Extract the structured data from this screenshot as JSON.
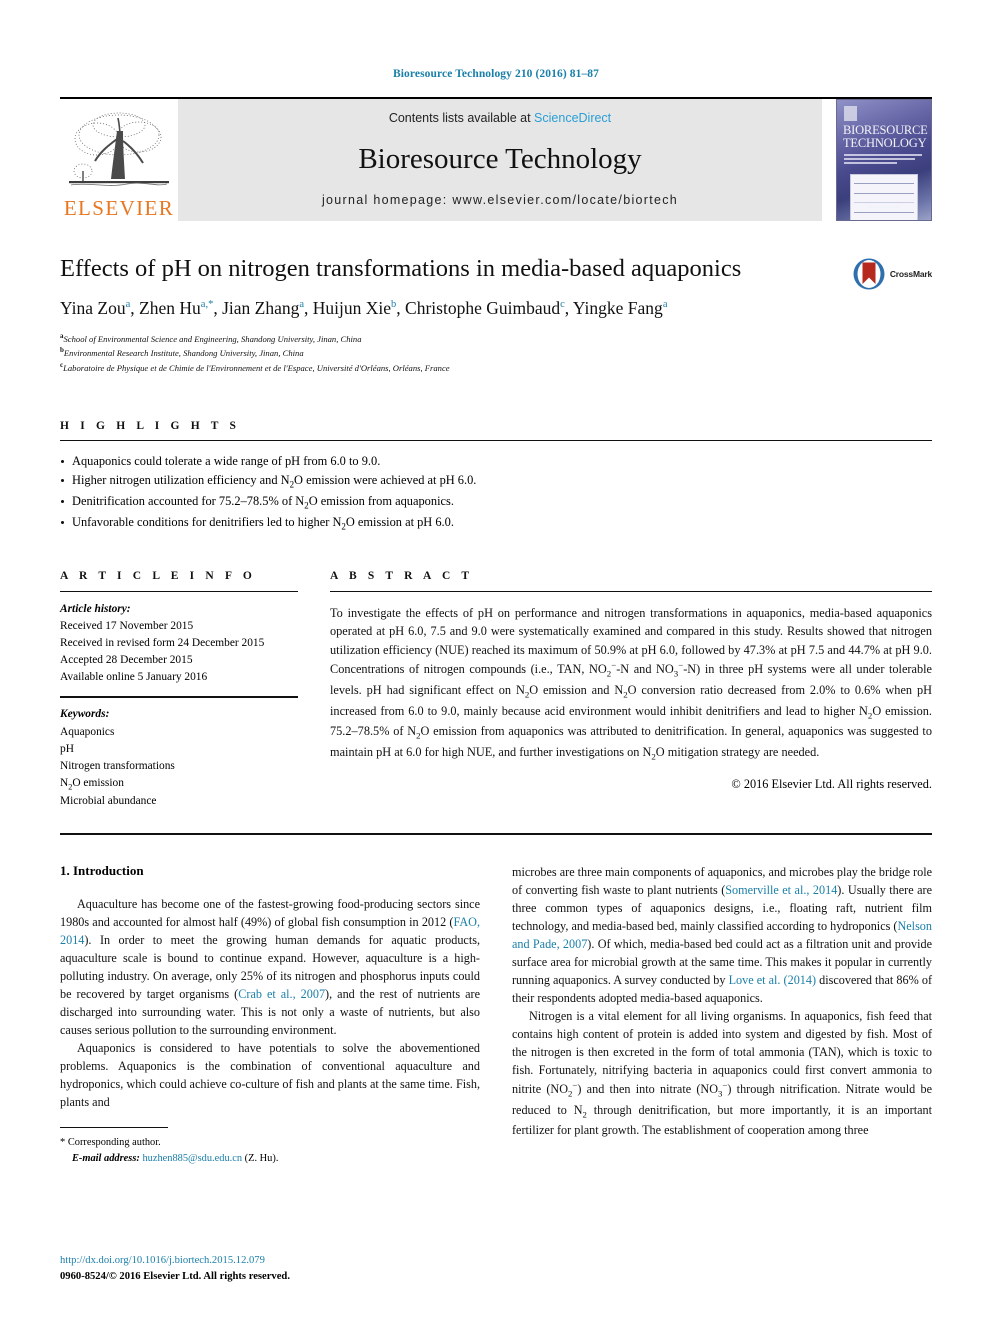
{
  "running_head": "Bioresource Technology 210 (2016) 81–87",
  "masthead": {
    "contents_prefix": "Contents lists available at ",
    "sciencedirect": "ScienceDirect",
    "journal_name": "Bioresource Technology",
    "homepage": "journal homepage: www.elsevier.com/locate/biortech",
    "publisher_logo_text": "ELSEVIER",
    "cover_title_line1": "BIORESOURCE",
    "cover_title_line2": "TECHNOLOGY"
  },
  "article": {
    "title": "Effects of pH on nitrogen transformations in media-based aquaponics",
    "crossmark_label": "CrossMark",
    "authors_html": "Yina Zou<sup>a</sup>, Zhen Hu<sup>a,*</sup>, Jian Zhang<sup>a</sup>, Huijun Xie<sup>b</sup>, Christophe Guimbaud<sup>c</sup>, Yingke Fang<sup>a</sup>",
    "affiliations": [
      {
        "marker": "a",
        "text": "School of Environmental Science and Engineering, Shandong University, Jinan, China"
      },
      {
        "marker": "b",
        "text": "Environmental Research Institute, Shandong University, Jinan, China"
      },
      {
        "marker": "c",
        "text": "Laboratoire de Physique et de Chimie de l'Environnement et de l'Espace, Université d'Orléans, Orléans, France"
      }
    ]
  },
  "highlights": {
    "heading": "H I G H L I G H T S",
    "items_html": [
      "Aquaponics could tolerate a wide range of pH from 6.0 to 9.0.",
      "Higher nitrogen utilization efficiency and N<sub>2</sub>O emission were achieved at pH 6.0.",
      "Denitrification accounted for 75.2–78.5% of N<sub>2</sub>O emission from aquaponics.",
      "Unfavorable conditions for denitrifiers led to higher N<sub>2</sub>O emission at pH 6.0."
    ]
  },
  "article_info": {
    "heading": "A R T I C L E    I N F O",
    "history_head": "Article history:",
    "history": [
      "Received 17 November 2015",
      "Received in revised form 24 December 2015",
      "Accepted 28 December 2015",
      "Available online 5 January 2016"
    ],
    "keywords_head": "Keywords:",
    "keywords_html": [
      "Aquaponics",
      "pH",
      "Nitrogen transformations",
      "N<sub>2</sub>O emission",
      "Microbial abundance"
    ]
  },
  "abstract": {
    "heading": "A B S T R A C T",
    "body_html": "To investigate the effects of pH on performance and nitrogen transformations in aquaponics, media-based aquaponics operated at pH 6.0, 7.5 and 9.0 were systematically examined and compared in this study. Results showed that nitrogen utilization efficiency (NUE) reached its maximum of 50.9% at pH 6.0, followed by 47.3% at pH 7.5 and 44.7% at pH 9.0. Concentrations of nitrogen compounds (i.e., TAN, NO<sub>2</sub><sup class=\"min\">&minus;</sup>-N and NO<sub>3</sub><sup class=\"min\">&minus;</sup>-N) in three pH systems were all under tolerable levels. pH had significant effect on N<sub>2</sub>O emission and N<sub>2</sub>O conversion ratio decreased from 2.0% to 0.6% when pH increased from 6.0 to 9.0, mainly because acid environment would inhibit denitrifiers and lead to higher N<sub>2</sub>O emission. 75.2–78.5% of N<sub>2</sub>O emission from aquaponics was attributed to denitrification. In general, aquaponics was suggested to maintain pH at 6.0 for high NUE, and further investigations on N<sub>2</sub>O mitigation strategy are needed.",
    "copyright": "© 2016 Elsevier Ltd. All rights reserved."
  },
  "introduction": {
    "heading": "1. Introduction",
    "left_paragraphs_html": [
      "Aquaculture has become one of the fastest-growing food-producing sectors since 1980s and accounted for almost half (49%) of global fish consumption in 2012 (<span class=\"ref\">FAO, 2014</span>). In order to meet the growing human demands for aquatic products, aquaculture scale is bound to continue expand. However, aquaculture is a high-polluting industry. On average, only 25% of its nitrogen and phosphorus inputs could be recovered by target organisms (<span class=\"ref\">Crab et al., 2007</span>), and the rest of nutrients are discharged into surrounding water. This is not only a waste of nutrients, but also causes serious pollution to the surrounding environment.",
      "Aquaponics is considered to have potentials to solve the abovementioned problems. Aquaponics is the combination of conventional aquaculture and hydroponics, which could achieve co-culture of fish and plants at the same time. Fish, plants and"
    ],
    "right_paragraphs_html": [
      "microbes are three main components of aquaponics, and microbes play the bridge role of converting fish waste to plant nutrients (<span class=\"ref\">Somerville et al., 2014</span>). Usually there are three common types of aquaponics designs, i.e., floating raft, nutrient film technology, and media-based bed, mainly classified according to hydroponics (<span class=\"ref\">Nelson and Pade, 2007</span>). Of which, media-based bed could act as a filtration unit and provide surface area for microbial growth at the same time. This makes it popular in currently running aquaponics. A survey conducted by <span class=\"ref\">Love et al. (2014)</span> discovered that 86% of their respondents adopted media-based aquaponics.",
      "Nitrogen is a vital element for all living organisms. In aquaponics, fish feed that contains high content of protein is added into system and digested by fish. Most of the nitrogen is then excreted in the form of total ammonia (TAN), which is toxic to fish. Fortunately, nitrifying bacteria in aquaponics could first convert ammonia to nitrite (NO<sub>2</sub><sup class=\"min\">&minus;</sup>) and then into nitrate (NO<sub>3</sub><sup class=\"min\">&minus;</sup>) through nitrification. Nitrate would be reduced to N<sub>2</sub> through denitrification, but more importantly, it is an important fertilizer for plant growth. The establishment of cooperation among three"
    ]
  },
  "footnote": {
    "star": "*",
    "corresponding": "Corresponding author.",
    "email_label": "E-mail address:",
    "email": "huzhen885@sdu.edu.cn",
    "email_suffix": " (Z. Hu)."
  },
  "page_footer": {
    "doi": "http://dx.doi.org/10.1016/j.biortech.2015.12.079",
    "issn_line": "0960-8524/© 2016 Elsevier Ltd. All rights reserved."
  },
  "colors": {
    "link": "#1a7fa8",
    "sciencedirect": "#2a9fd6",
    "elsevier_orange": "#E87722",
    "masthead_bg": "#e6e6e6"
  }
}
